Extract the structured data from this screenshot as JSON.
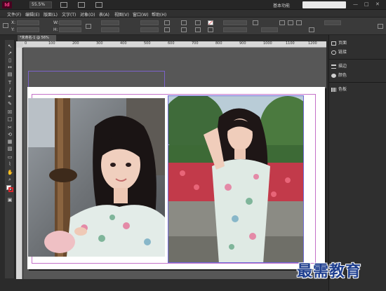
{
  "app": {
    "logo": "Id",
    "zoom": "55.5%",
    "workspace": "基本功能",
    "window_controls": {
      "minimize": "—",
      "maximize": "□",
      "close": "✕"
    }
  },
  "menu": [
    "文件(F)",
    "编辑(E)",
    "版面(L)",
    "文字(T)",
    "对象(O)",
    "表(A)",
    "视图(V)",
    "窗口(W)",
    "帮助(H)"
  ],
  "control_panel": {
    "labels": {
      "x": "X:",
      "y": "Y:",
      "w": "W:",
      "h": "H:"
    }
  },
  "document": {
    "tab_label": "*未命名-1 @ 56%"
  },
  "ruler": {
    "ticks": [
      "0",
      "100",
      "200",
      "300",
      "400",
      "500",
      "600",
      "700",
      "800",
      "900",
      "1000",
      "1100",
      "1200"
    ]
  },
  "panels": [
    {
      "label": "页面",
      "icon": "pages-icon"
    },
    {
      "label": "链接",
      "icon": "links-icon"
    },
    {
      "label": "描边",
      "icon": "stroke-icon"
    },
    {
      "label": "颜色",
      "icon": "color-icon"
    },
    {
      "label": "色板",
      "icon": "swatches-icon"
    }
  ],
  "tools": [
    "selection-tool",
    "direct-selection-tool",
    "page-tool",
    "gap-tool",
    "content-collector-tool",
    "type-tool",
    "line-tool",
    "pen-tool",
    "pencil-tool",
    "rectangle-frame-tool",
    "rectangle-tool",
    "scissors-tool",
    "free-transform-tool",
    "gradient-swatch-tool",
    "gradient-feather-tool",
    "note-tool",
    "eyedropper-tool",
    "hand-tool",
    "zoom-tool"
  ],
  "watermark": "最需教育",
  "colors": {
    "accent": "#49021f",
    "guide_bleed": "#7b62c9",
    "guide_margin": "#c471c9",
    "stroke": "#d6252b"
  }
}
